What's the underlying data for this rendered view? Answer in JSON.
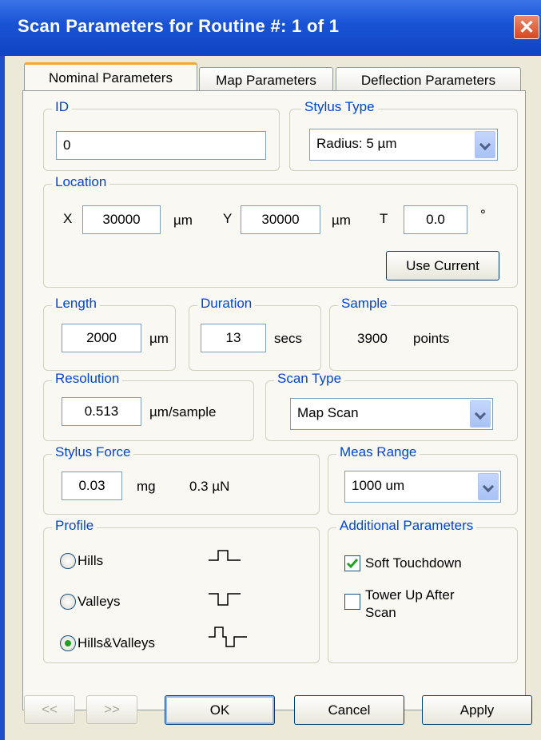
{
  "window": {
    "title": "Scan Parameters for Routine #: 1 of 1",
    "close_glyph": "✕"
  },
  "tabs": [
    "Nominal Parameters",
    "Map Parameters",
    "Deflection Parameters"
  ],
  "id_group": {
    "label": "ID",
    "value": "0"
  },
  "stylus_type": {
    "label": "Stylus Type",
    "value": "Radius: 5 µm"
  },
  "location": {
    "label": "Location",
    "x_label": "X",
    "x_value": "30000",
    "x_unit": "µm",
    "y_label": "Y",
    "y_value": "30000",
    "y_unit": "µm",
    "t_label": "T",
    "t_value": "0.0",
    "t_unit": "°",
    "use_current": "Use Current"
  },
  "length": {
    "label": "Length",
    "value": "2000",
    "unit": "µm"
  },
  "duration": {
    "label": "Duration",
    "value": "13",
    "unit": "secs"
  },
  "sample": {
    "label": "Sample",
    "value": "3900",
    "unit": "points"
  },
  "resolution": {
    "label": "Resolution",
    "value": "0.513",
    "unit": "µm/sample"
  },
  "scan_type": {
    "label": "Scan Type",
    "value": "Map Scan"
  },
  "stylus_force": {
    "label": "Stylus Force",
    "value": "0.03",
    "unit": "mg",
    "newtons": "0.3 µN"
  },
  "meas_range": {
    "label": "Meas Range",
    "value": "1000 um"
  },
  "profile": {
    "label": "Profile",
    "options": [
      "Hills",
      "Valleys",
      "Hills&Valleys"
    ],
    "selected": "Hills&Valleys"
  },
  "additional": {
    "label": "Additional Parameters",
    "soft_touchdown": "Soft Touchdown",
    "tower_up_line1": "Tower Up After",
    "tower_up_line2": "Scan"
  },
  "buttons": {
    "prev": "<<",
    "next": ">>",
    "ok": "OK",
    "cancel": "Cancel",
    "apply": "Apply"
  },
  "colors": {
    "title_bar": "#1a55d6",
    "group_label": "#0046d5",
    "tab_highlight": "#f7a82b"
  }
}
